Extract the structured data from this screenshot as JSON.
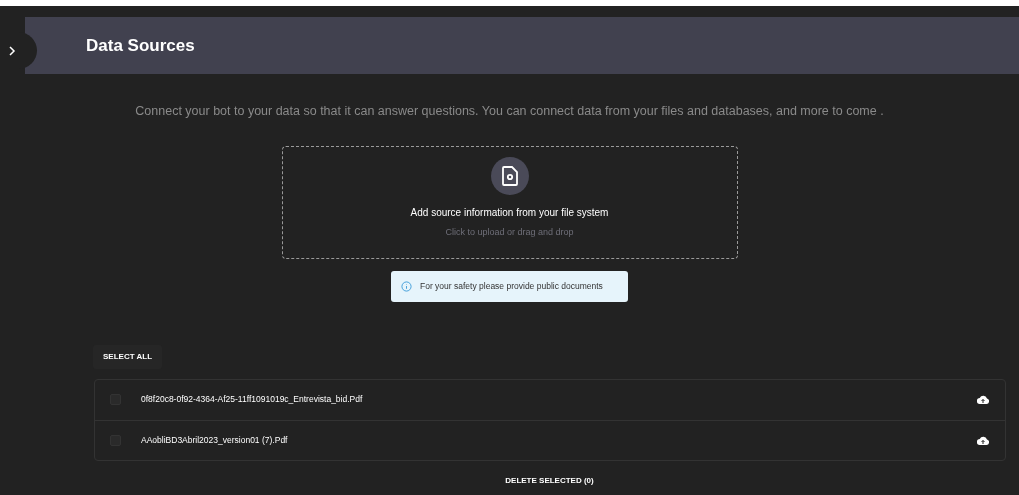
{
  "header": {
    "title": "Data Sources"
  },
  "intro": "Connect your bot to your data so that it can answer questions. You can connect data from your files and databases, and more to come .",
  "dropzone": {
    "title": "Add source information from your file system",
    "hint": "Click to upload or drag and drop"
  },
  "notice": "For your safety please provide public documents",
  "select_all": "SELECT ALL",
  "files": [
    {
      "name": "0f8f20c8-0f92-4364-Af25-11ff1091019c_Entrevista_bid.Pdf",
      "checked": false
    },
    {
      "name": "AAobliBD3Abril2023_version01 (7).Pdf",
      "checked": false
    }
  ],
  "delete_button": "DELETE SELECTED (0)"
}
